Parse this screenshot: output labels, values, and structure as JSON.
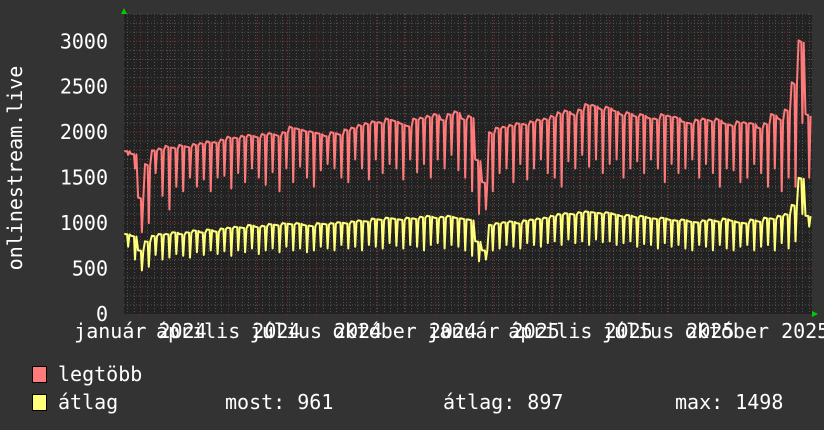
{
  "chart_data": {
    "type": "line",
    "ylabel": "onlinestream.live",
    "ylim": [
      0,
      3300
    ],
    "yticks": [
      0,
      500,
      1000,
      1500,
      2000,
      2500,
      3000
    ],
    "xlim": [
      "2023-12-15",
      "2025-11-27"
    ],
    "xticks": [
      {
        "date": "2024-01-01",
        "label": "január 2024"
      },
      {
        "date": "2024-04-01",
        "label": "április 2024"
      },
      {
        "date": "2024-07-01",
        "label": "július 2024"
      },
      {
        "date": "2024-10-01",
        "label": "október 2024"
      },
      {
        "date": "2025-01-01",
        "label": "január 2025"
      },
      {
        "date": "2025-04-01",
        "label": "április 2025"
      },
      {
        "date": "2025-07-01",
        "label": "július 2025"
      },
      {
        "date": "2025-10-01",
        "label": "október 2025"
      }
    ],
    "grid": true,
    "sampling": "weekly peak and trough",
    "series": [
      {
        "name": "legtöbb",
        "color": "#ff7a7a",
        "peaks": [
          1790,
          1760,
          1280,
          1650,
          1800,
          1820,
          1850,
          1830,
          1860,
          1840,
          1870,
          1880,
          1900,
          1890,
          1920,
          1950,
          1940,
          1960,
          1970,
          1950,
          1980,
          1990,
          1970,
          2000,
          2060,
          2040,
          2020,
          2010,
          1990,
          1960,
          2000,
          1980,
          2030,
          2050,
          2080,
          2100,
          2120,
          2110,
          2150,
          2130,
          2100,
          2070,
          2150,
          2160,
          2180,
          2200,
          2140,
          2200,
          2230,
          2150,
          2180,
          1700,
          1450,
          2000,
          2050,
          2060,
          2080,
          2100,
          2090,
          2120,
          2140,
          2150,
          2180,
          2220,
          2240,
          2200,
          2250,
          2310,
          2300,
          2260,
          2280,
          2240,
          2200,
          2220,
          2180,
          2200,
          2160,
          2150,
          2200,
          2180,
          2170,
          2120,
          2100,
          2140,
          2150,
          2130,
          2150,
          2100,
          2080,
          2120,
          2110,
          2100,
          2050,
          2100,
          2200,
          2150,
          2250,
          2550,
          3010,
          2200
        ],
        "troughs": [
          1750,
          1600,
          900,
          1000,
          1550,
          1300,
          1150,
          1400,
          1350,
          1500,
          1400,
          1480,
          1350,
          1500,
          1520,
          1380,
          1550,
          1450,
          1600,
          1500,
          1420,
          1560,
          1350,
          1600,
          1450,
          1620,
          1500,
          1400,
          1580,
          1650,
          1600,
          1500,
          1450,
          1700,
          1600,
          1480,
          1700,
          1550,
          1650,
          1600,
          1480,
          1700,
          1560,
          1650,
          1500,
          1700,
          1600,
          1750,
          1580,
          1500,
          1350,
          1100,
          1150,
          1350,
          1550,
          1600,
          1450,
          1650,
          1480,
          1600,
          1700,
          1550,
          1500,
          1400,
          1680,
          1600,
          1750,
          1620,
          1700,
          1550,
          1650,
          1700,
          1500,
          1600,
          1680,
          1550,
          1700,
          1600,
          1450,
          1650,
          1550,
          1600,
          1700,
          1500,
          1650,
          1550,
          1400,
          1600,
          1580,
          1450,
          1500,
          1650,
          1550,
          1400,
          1600,
          1350,
          1500,
          1400,
          2100,
          1500
        ]
      },
      {
        "name": "átlag",
        "color": "#ffff7a",
        "peaks": [
          880,
          860,
          700,
          800,
          860,
          880,
          880,
          900,
          880,
          900,
          920,
          900,
          930,
          910,
          940,
          950,
          960,
          950,
          980,
          960,
          970,
          990,
          980,
          1000,
          990,
          1000,
          980,
          970,
          1000,
          990,
          1000,
          1010,
          1000,
          1020,
          1030,
          1020,
          1050,
          1040,
          1060,
          1050,
          1040,
          1060,
          1050,
          1070,
          1080,
          1060,
          1070,
          1080,
          1060,
          1050,
          1040,
          800,
          700,
          980,
          1000,
          1010,
          1020,
          1000,
          1030,
          1040,
          1050,
          1060,
          1080,
          1100,
          1110,
          1100,
          1120,
          1130,
          1120,
          1110,
          1120,
          1100,
          1080,
          1090,
          1070,
          1080,
          1060,
          1050,
          1060,
          1040,
          1030,
          1040,
          1020,
          1010,
          1030,
          1040,
          1020,
          1050,
          1030,
          1010,
          1000,
          1040,
          1020,
          1060,
          1050,
          1080,
          1100,
          1200,
          1498,
          1080
        ],
        "troughs": [
          740,
          600,
          480,
          520,
          650,
          600,
          620,
          660,
          640,
          620,
          680,
          650,
          700,
          660,
          690,
          640,
          700,
          680,
          720,
          660,
          700,
          720,
          680,
          740,
          700,
          720,
          680,
          700,
          740,
          720,
          700,
          760,
          720,
          740,
          700,
          760,
          740,
          720,
          780,
          750,
          720,
          760,
          740,
          700,
          760,
          780,
          720,
          760,
          740,
          700,
          640,
          580,
          600,
          700,
          720,
          760,
          740,
          720,
          780,
          760,
          740,
          780,
          800,
          760,
          820,
          780,
          800,
          760,
          820,
          790,
          800,
          760,
          780,
          800,
          740,
          770,
          760,
          720,
          780,
          740,
          760,
          720,
          700,
          760,
          740,
          700,
          760,
          720,
          700,
          740,
          760,
          700,
          740,
          760,
          700,
          780,
          720,
          800,
          1100,
          961
        ]
      }
    ]
  },
  "legend": {
    "items": [
      {
        "label": "legtöbb",
        "color": "#ff7a7a"
      },
      {
        "label": "átlag",
        "color": "#ffff7a"
      }
    ],
    "stats": {
      "current": "most: 961",
      "average": "átlag: 897",
      "max": "max: 1498"
    }
  },
  "colors": {
    "background": "#333333",
    "plot": "#222222",
    "major_grid": "#7a3030",
    "minor_grid": "#555555",
    "arrow": "#00cc00"
  }
}
